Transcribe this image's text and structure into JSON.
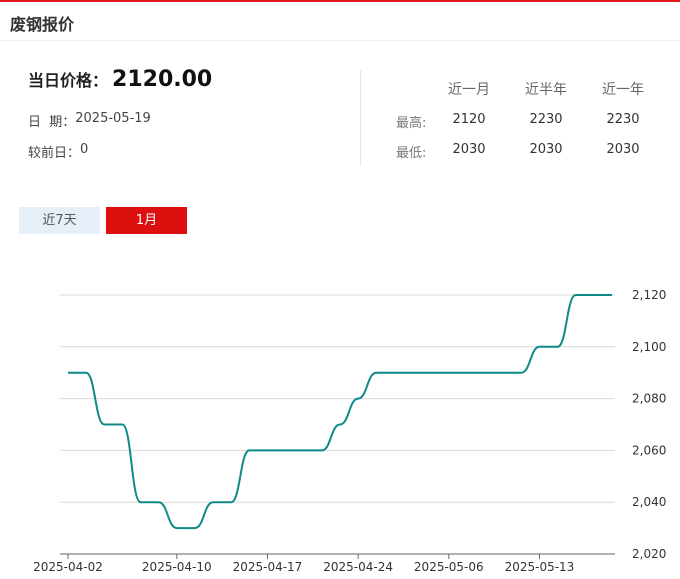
{
  "header": {
    "title": "废钢报价"
  },
  "summary": {
    "price_label": "当日价格：",
    "price_value": "2120.00",
    "date_label": "日  期：",
    "date_value": "2025-05-19",
    "change_label": "较前日：",
    "change_value": "0"
  },
  "stats": {
    "columns": [
      "近一月",
      "近半年",
      "近一年"
    ],
    "rows": [
      {
        "label": "最高:",
        "values": [
          "2120",
          "2230",
          "2230"
        ]
      },
      {
        "label": "最低:",
        "values": [
          "2030",
          "2030",
          "2030"
        ]
      }
    ]
  },
  "tabs": [
    {
      "label": "近7天",
      "active": false
    },
    {
      "label": "1月",
      "active": true
    }
  ],
  "colors": {
    "accent": "#dd1010",
    "line": "#0f8a8a",
    "tab_inactive": "#e6eef7"
  },
  "chart_data": {
    "type": "line",
    "title": "",
    "xlabel": "",
    "ylabel": "",
    "ylim": [
      2020,
      2120
    ],
    "yticks": [
      2020,
      2040,
      2060,
      2080,
      2100,
      2120
    ],
    "ytick_labels": [
      "2,020",
      "2,040",
      "2,060",
      "2,080",
      "2,100",
      "2,120"
    ],
    "x_tick_labels": [
      "2025-04-02",
      "2025-04-10",
      "2025-04-17",
      "2025-04-24",
      "2025-05-06",
      "2025-05-13"
    ],
    "x_tick_indices": [
      0,
      6,
      11,
      16,
      21,
      26
    ],
    "grid": true,
    "series": [
      {
        "x": [
          "2025-04-02",
          "2025-04-03",
          "2025-04-04",
          "2025-04-07",
          "2025-04-08",
          "2025-04-09",
          "2025-04-10",
          "2025-04-11",
          "2025-04-14",
          "2025-04-15",
          "2025-04-16",
          "2025-04-17",
          "2025-04-18",
          "2025-04-21",
          "2025-04-22",
          "2025-04-23",
          "2025-04-24",
          "2025-04-25",
          "2025-04-28",
          "2025-04-29",
          "2025-04-30",
          "2025-05-06",
          "2025-05-07",
          "2025-05-08",
          "2025-05-09",
          "2025-05-12",
          "2025-05-13",
          "2025-05-14",
          "2025-05-15",
          "2025-05-16",
          "2025-05-19"
        ],
        "values": [
          2090,
          2090,
          2070,
          2070,
          2040,
          2040,
          2030,
          2030,
          2040,
          2040,
          2060,
          2060,
          2060,
          2060,
          2060,
          2070,
          2080,
          2090,
          2090,
          2090,
          2090,
          2090,
          2090,
          2090,
          2090,
          2090,
          2100,
          2100,
          2120,
          2120,
          2120
        ]
      }
    ]
  }
}
